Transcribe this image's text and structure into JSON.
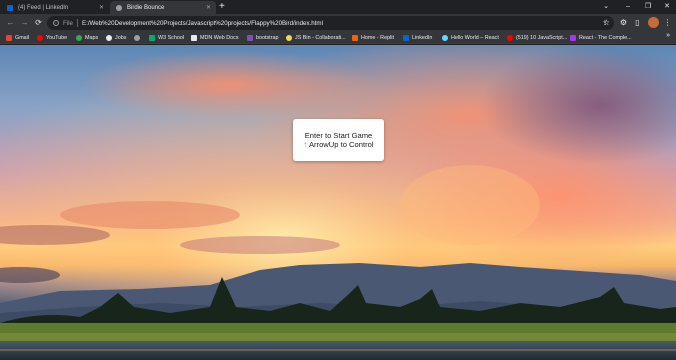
{
  "tabs": [
    {
      "title": "(4) Feed | LinkedIn",
      "favicon_color": "#0a66c2",
      "active": false
    },
    {
      "title": "Birdie Bounce",
      "favicon_color": "#9aa0a6",
      "active": true
    }
  ],
  "new_tab_symbol": "+",
  "window_controls": {
    "minimize": "–",
    "maximize": "❐",
    "close": "✕",
    "dropdown": "⌄"
  },
  "nav": {
    "back": "←",
    "forward": "→",
    "reload": "⟳"
  },
  "address": {
    "info": "i",
    "scheme_label": "File",
    "url": "E:/Web%20Development%20Projects/Javascript%20projects/Flappy%20Bird/index.html"
  },
  "toolbar_icons": {
    "share": "⇪",
    "star": "☆",
    "extensions": "⚙",
    "sidepanel": "▯",
    "menu": "⋮"
  },
  "bookmarks": [
    {
      "label": "Gmail",
      "color": "#ea4335"
    },
    {
      "label": "YouTube",
      "color": "#ff0000"
    },
    {
      "label": "Maps",
      "color": "#34a853"
    },
    {
      "label": "Jobs",
      "color": "#e8eaed"
    },
    {
      "label": "",
      "color": "#9aa0a6"
    },
    {
      "label": "W3 School",
      "color": "#04aa6d"
    },
    {
      "label": "MDN Web Docs",
      "color": "#e8eaed"
    },
    {
      "label": "bootstrap",
      "color": "#7952b3"
    },
    {
      "label": "JS Bin - Collaborati...",
      "color": "#f0db4f"
    },
    {
      "label": "Home - Replit",
      "color": "#f26207"
    },
    {
      "label": "LinkedIn",
      "color": "#0a66c2"
    },
    {
      "label": "Hello World – React",
      "color": "#61dafb"
    },
    {
      "label": "(519) 10 JavaScript...",
      "color": "#ff0000"
    },
    {
      "label": "React - The Comple...",
      "color": "#a435f0"
    }
  ],
  "bookmarks_more": "»",
  "game": {
    "start_line": "Enter to Start Game",
    "control_arrow": "↑",
    "control_line": "ArrowUp to Control"
  }
}
